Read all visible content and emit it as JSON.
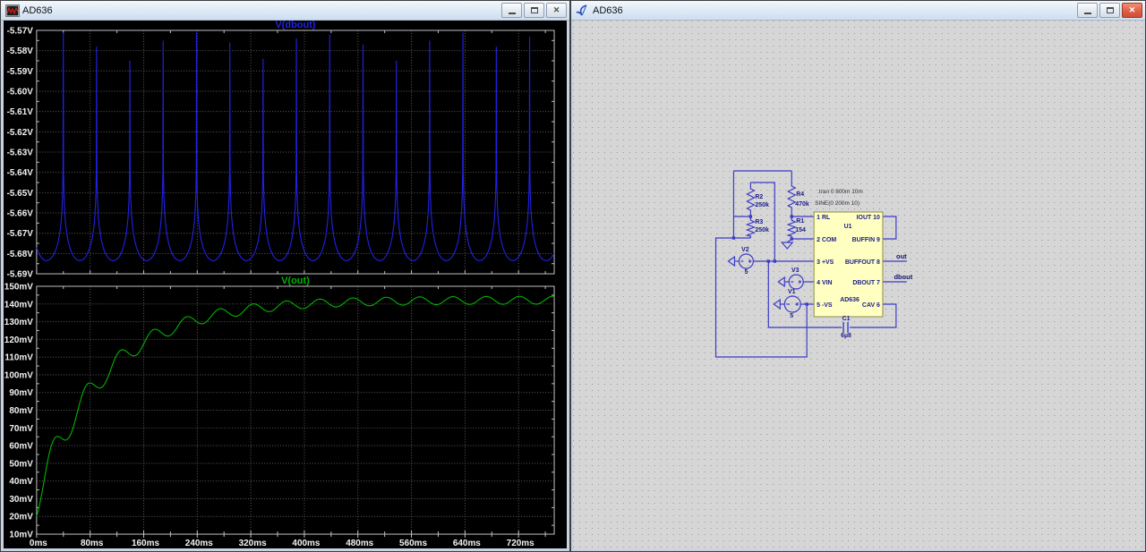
{
  "left_window": {
    "title": "AD636",
    "kind": "waveform-viewer"
  },
  "right_window": {
    "title": "AD636",
    "kind": "schematic-editor",
    "schematic": {
      "directives": [
        ".tran 0 800m 10m",
        "SINE(0 200m 10)"
      ],
      "u1": {
        "ref": "U1",
        "part": "AD636",
        "pins_left": [
          "1 RL",
          "2 COM",
          "3 +VS",
          "4 VIN",
          "5 -VS"
        ],
        "pins_right": [
          "IOUT 10",
          "BUFFIN 9",
          "BUFFOUT 8",
          "DBOUT 7",
          "CAV 6"
        ]
      },
      "r1": {
        "ref": "R1",
        "value": "154"
      },
      "r2": {
        "ref": "R2",
        "value": "250k"
      },
      "r3": {
        "ref": "R3",
        "value": "250k"
      },
      "r4": {
        "ref": "R4",
        "value": "470k"
      },
      "v1": {
        "ref": "V1",
        "value": "5"
      },
      "v2": {
        "ref": "V2",
        "value": "5"
      },
      "v3": {
        "ref": "V3"
      },
      "c1": {
        "ref": "C1",
        "value": "6µ8"
      },
      "net_labels": {
        "out": "out",
        "dbout": "dbout"
      },
      "colors": {
        "wire": "#3b3bc8",
        "chip_fill": "#ffffc2",
        "chip_border": "#8f8f4a",
        "background": "#d6d6d6"
      }
    }
  },
  "chart_data": [
    {
      "type": "line",
      "title": "V(dbout)",
      "title_color": "#2121e6",
      "xlim_ms": [
        10,
        787
      ],
      "ylim": [
        -5.69,
        -5.57
      ],
      "y_tick_labels": [
        "-5.57V",
        "-5.58V",
        "-5.59V",
        "-5.60V",
        "-5.61V",
        "-5.62V",
        "-5.63V",
        "-5.64V",
        "-5.65V",
        "-5.66V",
        "-5.67V",
        "-5.68V",
        "-5.69V"
      ],
      "x_tick_labels": [
        "0ms",
        "80ms",
        "160ms",
        "240ms",
        "320ms",
        "400ms",
        "480ms",
        "560ms",
        "640ms",
        "720ms"
      ],
      "x_tick_step_ms": 80,
      "grid": true,
      "series": [
        {
          "name": "V(dbout)",
          "color": "#2121e6",
          "model": "log-rectified-sine",
          "valley_v": -5.6835,
          "log_k": 0.028,
          "sine_hz": 10,
          "spike_interval_ms": 50,
          "spike_peaks_v": [
            -5.571,
            -5.578,
            -5.585,
            -5.575,
            -5.571,
            -5.576,
            -5.584,
            -5.574,
            -5.572,
            -5.577,
            -5.585,
            -5.575,
            -5.571,
            -5.578,
            -5.573
          ]
        }
      ]
    },
    {
      "type": "line",
      "title": "V(out)",
      "title_color": "#00b400",
      "xlim_ms": [
        10,
        787
      ],
      "ylim": [
        10,
        150
      ],
      "y_tick_labels": [
        "150mV",
        "140mV",
        "130mV",
        "120mV",
        "110mV",
        "100mV",
        "90mV",
        "80mV",
        "70mV",
        "60mV",
        "50mV",
        "40mV",
        "30mV",
        "20mV",
        "10mV"
      ],
      "x_tick_labels": [
        "0ms",
        "80ms",
        "160ms",
        "240ms",
        "320ms",
        "400ms",
        "480ms",
        "560ms",
        "640ms",
        "720ms"
      ],
      "x_tick_step_ms": 80,
      "grid": true,
      "series": [
        {
          "name": "V(out)",
          "color": "#00b400",
          "model": "exp-settle-with-ripple",
          "v_start_mV": 20,
          "v_final_mV": 140,
          "tau_ms": 105,
          "ripple_hz": 20,
          "ripple_base_mV": 2.2,
          "ripple_decay_mV": 8,
          "ripple_decay_tau_ms": 120,
          "t_start_ms": 10
        }
      ]
    }
  ]
}
